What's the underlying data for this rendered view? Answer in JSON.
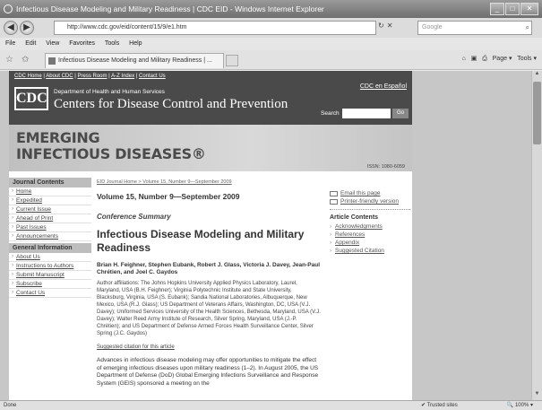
{
  "window": {
    "title": "Infectious Disease Modeling and Military Readiness | CDC EID - Windows Internet Explorer"
  },
  "address": {
    "url": "http://www.cdc.gov/eid/content/15/9/e1.htm",
    "search_placeholder": "Google"
  },
  "menu": [
    "File",
    "Edit",
    "View",
    "Favorites",
    "Tools",
    "Help"
  ],
  "tab": {
    "title": "Infectious Disease Modeling and Military Readiness | ..."
  },
  "commands": {
    "page": "Page",
    "tools": "Tools"
  },
  "cdc": {
    "top_links": [
      "CDC Home",
      "About CDC",
      "Press Room",
      "A-Z Index",
      "Contact Us"
    ],
    "espanol": "CDC en Español",
    "logo": "CDC",
    "dept": "Department of Health and Human Services",
    "centers": "Centers for Disease Control and Prevention",
    "search_label": "Search",
    "search_go": "Go"
  },
  "eid": {
    "line1": "EMERGING",
    "line2": "INFECTIOUS DISEASES",
    "issn": "ISSN: 1080-6059"
  },
  "sidebar": {
    "journal_heading": "Journal Contents",
    "journal_items": [
      "Home",
      "Expedited",
      "Current Issue",
      "Ahead of Print",
      "Past Issues",
      "Announcements"
    ],
    "general_heading": "General Information",
    "general_items": [
      "About Us",
      "Instructions to Authors",
      "Submit Manuscript",
      "Subscribe",
      "Contact Us"
    ]
  },
  "article": {
    "breadcrumb": "EID Journal Home > Volume 15, Number 9—September 2009",
    "volume": "Volume 15, Number 9—September 2009",
    "section": "Conference Summary",
    "title": "Infectious Disease Modeling and Military Readiness",
    "authors": "Brian H. Feighner, Stephen Eubank, Robert J. Glass, Victoria J. Davey, Jean-Paul Chrétien, and Joel C. Gaydos",
    "affiliations": "Author affiliations: The Johns Hopkins University Applied Physics Laboratory, Laurel, Maryland, USA (B.H. Feighner); Virginia Polytechnic Institute and State University, Blacksburg, Virginia, USA (S. Eubank); Sandia National Laboratories, Albuquerque, New Mexico, USA (R.J. Glass); US Department of Veterans Affairs, Washington, DC, USA (V.J. Davey); Uniformed Services University of the Health Sciences, Bethesda, Maryland, USA (V.J. Davey); Walter Reed Army Institute of Research, Silver Spring, Maryland, USA (J.-P. Chrétien); and US Department of Defense Armed Forces Health Surveillance Center, Silver Spring (J.C. Gaydos)",
    "citation_link": "Suggested citation for this article",
    "body": "Advances in infectious disease modeling may offer opportunities to mitigate the effect of emerging infectious diseases upon military readiness (1–2). In August 2005, the US Department of Defense (DoD) Global Emerging Infections Surveillance and Response System (GEIS) sponsored a meeting on the"
  },
  "tools": {
    "email": "Email this page",
    "print": "Printer-friendly version",
    "contents_heading": "Article Contents",
    "contents_items": [
      "Acknowledgments",
      "References",
      "Appendix",
      "Suggested Citation"
    ]
  },
  "status": {
    "left": "Done",
    "sites": "Trusted sites",
    "zoom": "100%"
  }
}
